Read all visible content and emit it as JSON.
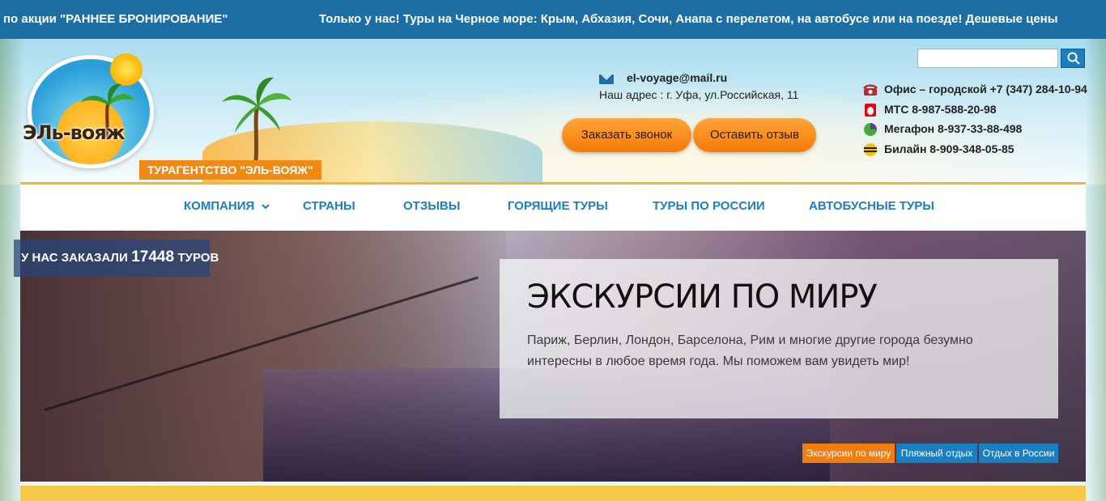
{
  "ticker": {
    "text_left": "по акции \"РАННЕЕ БРОНИРОВАНИЕ\"",
    "text_right": "Только у нас! Туры на Черное море: Крым, Абхазия, Сочи, Анапа с перелетом, на автобусе или на поезде! Дешевые цены"
  },
  "logo": {
    "text": "ЭЛь-вояж",
    "agency_label": "ТУРАГЕНТСТВО \"ЭЛЬ-ВОЯЖ\""
  },
  "contact": {
    "email": "el-voyage@mail.ru",
    "address": "Наш адрес : г. Уфа, ул.Российская, 11",
    "call_button": "Заказать звонок",
    "review_button": "Оставить отзыв"
  },
  "search": {
    "placeholder": "",
    "icon": "search-icon"
  },
  "phones": [
    {
      "icon": "phone-icon",
      "color": "#c0282d",
      "text": "Офис – городской +7 (347) 284-10-94"
    },
    {
      "icon": "mts-icon",
      "color": "#e30611",
      "text": "МТС 8-987-588-20-98"
    },
    {
      "icon": "megafon-icon",
      "color": "#4aa83a",
      "text": "Мегафон 8-937-33-88-498"
    },
    {
      "icon": "beeline-icon",
      "color": "#f5c400",
      "text": "Билайн 8-909-348-05-85"
    }
  ],
  "nav": {
    "items": [
      {
        "label": "КОМПАНИЯ",
        "has_dropdown": true
      },
      {
        "label": "СТРАНЫ"
      },
      {
        "label": "ОТЗЫВЫ"
      },
      {
        "label": "ГОРЯЩИЕ ТУРЫ"
      },
      {
        "label": "ТУРЫ ПО РОССИИ"
      },
      {
        "label": "АВТОБУСНЫЕ ТУРЫ"
      }
    ]
  },
  "counter": {
    "prefix": "У НАС ЗАКАЗАЛИ",
    "number": "17448",
    "suffix": "ТУРОВ"
  },
  "hero": {
    "title": "ЭКСКУРСИИ ПО МИРУ",
    "text": "Париж, Берлин, Лондон, Барселона, Рим и многие другие города безумно интересны в любое время года. Мы поможем вам увидеть мир!"
  },
  "slides": [
    {
      "label": "Экскурсии по миру",
      "active": true
    },
    {
      "label": "Пляжный отдых",
      "active": false
    },
    {
      "label": "Отдых в России",
      "active": false
    }
  ],
  "colors": {
    "brand_blue": "#1b7fbf",
    "accent_orange": "#f07d12",
    "nav_border": "#f5b530"
  }
}
